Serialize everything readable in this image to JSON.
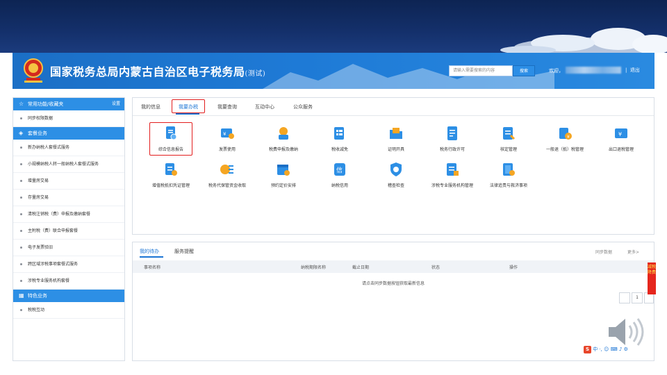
{
  "header": {
    "site_title": "国家税务总局内蒙古自治区电子税务局",
    "site_title_suffix": "(测试)",
    "search_placeholder": "请输入需要搜索的内容",
    "search_button": "搜索",
    "welcome": "欢迎，",
    "separator": "|",
    "logout": "退出"
  },
  "sidebar": {
    "section1_title": "常用功能/收藏夹",
    "section1_setting": "设置",
    "section1_items": [
      "同步权限数据"
    ],
    "section2_title": "套餐业务",
    "section2_items": [
      "新办纳税人套餐式服务",
      "小规模纳税人转一般纳税人套餐式服务",
      "增量房交易",
      "存量房交易",
      "清税注销税（费）申报及缴纳套餐",
      "主附税（费）联合申报套餐",
      "电子发票验旧",
      "跨区域涉税事项套餐式服务",
      "涉税专业服务机构套餐"
    ],
    "section3_title": "特色业务",
    "section3_items": [
      "税税互动"
    ]
  },
  "tabs": [
    "我的信息",
    "我要办税",
    "我要查询",
    "互动中心",
    "公众服务"
  ],
  "services_row1": [
    {
      "label": "综合信息报告",
      "icon": "document-person-icon"
    },
    {
      "label": "发票使用",
      "icon": "invoice-icon"
    },
    {
      "label": "税费申报及缴纳",
      "icon": "tax-declare-icon"
    },
    {
      "label": "税收减免",
      "icon": "tax-relief-icon"
    },
    {
      "label": "证明开具",
      "icon": "certificate-folder-icon"
    },
    {
      "label": "税务行政许可",
      "icon": "permit-icon"
    },
    {
      "label": "核定管理",
      "icon": "assessment-icon"
    },
    {
      "label": "一般退（抵）税管理",
      "icon": "refund-icon"
    },
    {
      "label": "出口退税管理",
      "icon": "export-refund-icon"
    }
  ],
  "services_row2": [
    {
      "label": "增值税抵扣凭证管理",
      "icon": "vat-voucher-icon"
    },
    {
      "label": "税务代保管资金收取",
      "icon": "custody-fund-icon"
    },
    {
      "label": "预约定价安排",
      "icon": "pricing-calendar-icon"
    },
    {
      "label": "纳税信用",
      "icon": "credit-icon"
    },
    {
      "label": "稽查检查",
      "icon": "inspection-shield-icon"
    },
    {
      "label": "涉税专业服务机构管理",
      "icon": "agency-icon"
    },
    {
      "label": "法律追责与救济事项",
      "icon": "legal-book-icon"
    }
  ],
  "todo": {
    "tab_active": "我的待办",
    "tab_other": "服务提醒",
    "sync": "同步数据",
    "more": "更多>",
    "columns": [
      "事项名称",
      "纳税期限名称",
      "截止日期",
      "状态",
      "操作"
    ],
    "empty_message": "请点击同步数据按钮获取最新信息",
    "page": "1"
  },
  "float_tag": "减税降费",
  "ime": "中 ·, ☺ ⌨ ♪ ⚙"
}
